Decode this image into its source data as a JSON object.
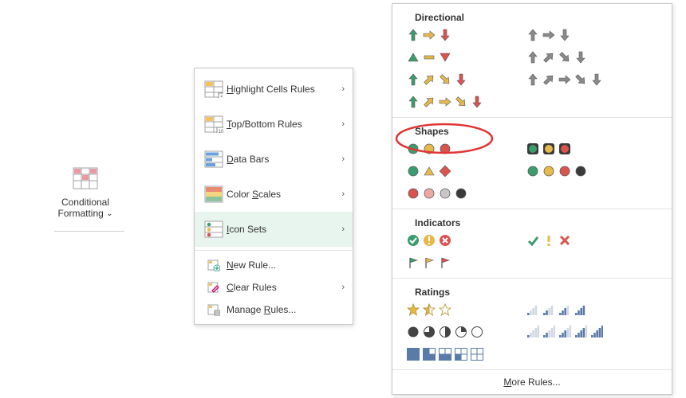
{
  "ribbon_button": {
    "line1": "Conditional",
    "line2": "Formatting",
    "caret": "⌄"
  },
  "menu": {
    "items": [
      {
        "label": "Highlight Cells Rules",
        "accel_index": 0,
        "has_arrow": true
      },
      {
        "label": "Top/Bottom Rules",
        "accel_index": 0,
        "has_arrow": true
      },
      {
        "label": "Data Bars",
        "accel_index": 0,
        "has_arrow": true
      },
      {
        "label": "Color Scales",
        "accel_index": 6,
        "has_arrow": true
      },
      {
        "label": "Icon Sets",
        "accel_index": 0,
        "has_arrow": true,
        "highlighted": true
      },
      {
        "sep": true
      },
      {
        "label": "New Rule...",
        "accel_index": 0,
        "compact": true
      },
      {
        "label": "Clear Rules",
        "accel_index": 0,
        "has_arrow": true,
        "compact": true
      },
      {
        "label": "Manage Rules...",
        "accel_index": 7,
        "compact": true
      }
    ]
  },
  "flyout": {
    "sections": {
      "directional": {
        "title": "Directional",
        "left": [
          "arrows3-color",
          "triangles3-color",
          "arrows4-color",
          "arrows5-color"
        ],
        "right": [
          "arrows3-gray",
          "arrows4-gray",
          "arrows5-gray"
        ]
      },
      "shapes": {
        "title": "Shapes",
        "left": [
          "traffic3-unrimmed",
          "traffic-mixed-3",
          "circles4-blackred"
        ],
        "right": [
          "traffic3-rimmed",
          "circles4-color"
        ]
      },
      "indicators": {
        "title": "Indicators",
        "left": [
          "symbols3-circled",
          "flags3"
        ],
        "right": [
          "symbols3-uncircled"
        ]
      },
      "ratings": {
        "title": "Ratings",
        "left": [
          "stars3",
          "quarters5",
          "boxes5"
        ],
        "right": [
          "bars4",
          "bars5"
        ]
      }
    },
    "more_label": "More Rules..."
  },
  "colors": {
    "green": "#3b9c6d",
    "yellow": "#e7b94a",
    "red": "#d9534f",
    "gray": "#8a8a8a",
    "darkgray": "#5b5b5b",
    "black": "#3a3a3a",
    "pink": "#eca9a4"
  }
}
